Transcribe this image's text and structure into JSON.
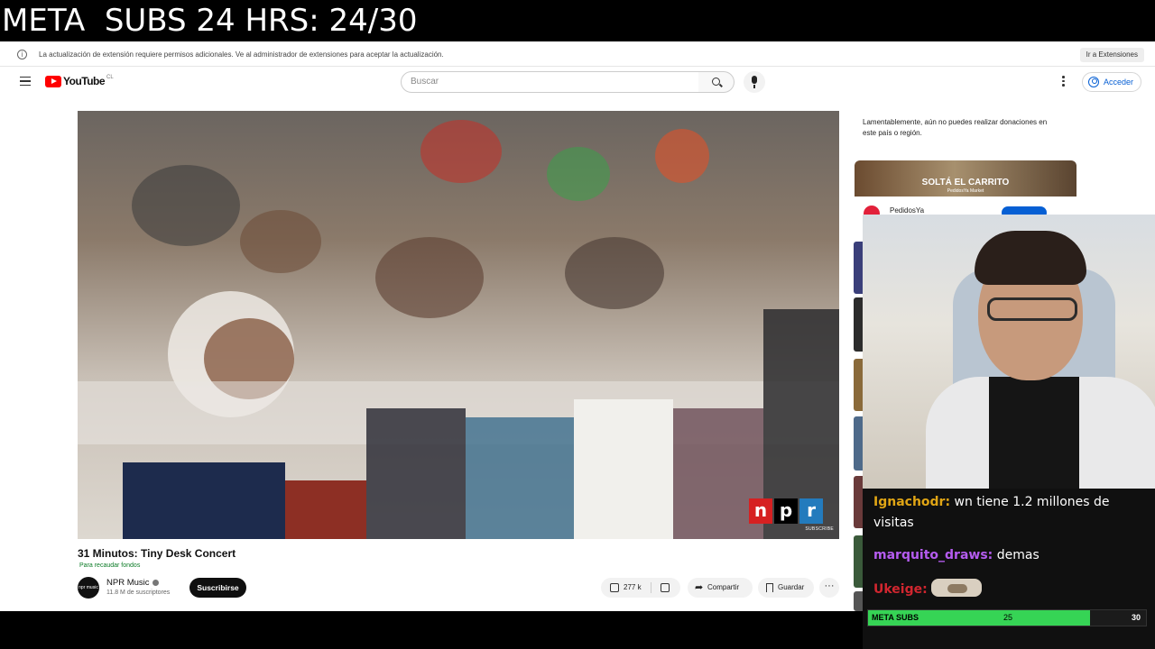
{
  "overlay": {
    "banner_text": "META  SUBS 24 HRS: 24/30"
  },
  "extension_bar": {
    "message": "La actualización de extensión requiere permisos adicionales. Ve al administrador de extensiones para aceptar la actualización.",
    "button_label": "Ir a Extensiones"
  },
  "header": {
    "logo_text": "YouTube",
    "country_code": "CL",
    "search_placeholder": "Buscar",
    "signin_label": "Acceder"
  },
  "video": {
    "title": "31 Minutos: Tiny Desk Concert",
    "fundraiser_label": "Para recaudar fondos",
    "watermark_letters": [
      "n",
      "p",
      "r"
    ],
    "watermark_colors": [
      "#d62021",
      "#000000",
      "#237bbd"
    ],
    "watermark_sub": "SUBSCRIBE"
  },
  "channel": {
    "name": "NPR Music",
    "subscribers": "11.8 M de suscriptores",
    "subscribe_label": "Suscribirse",
    "avatar_text": "npr music"
  },
  "actions": {
    "likes": "277 k",
    "share_label": "Compartir",
    "save_label": "Guardar",
    "more_label": "···"
  },
  "sidebar": {
    "donation_note": "Lamentablemente, aún no puedes realizar donaciones en este país o región.",
    "ad": {
      "title": "SOLTÁ EL CARRITO",
      "brand_line": "PedidosYa Market",
      "advertiser": "PedidosYa"
    }
  },
  "chat": {
    "messages": [
      {
        "user": "Ignachodr:",
        "text": " wn tiene 1.2 millones de visitas",
        "color": "#e0a515"
      },
      {
        "user": "marquito_draws:",
        "text": " demas",
        "color": "#b55cf0"
      },
      {
        "user": "Ukeige:",
        "text": "",
        "color": "#d1262f",
        "emote": "cat-emote"
      }
    ]
  },
  "goal": {
    "label": "META SUBS",
    "current": "25",
    "target": "30",
    "progress": 0.8,
    "fill_color": "#36d455"
  }
}
